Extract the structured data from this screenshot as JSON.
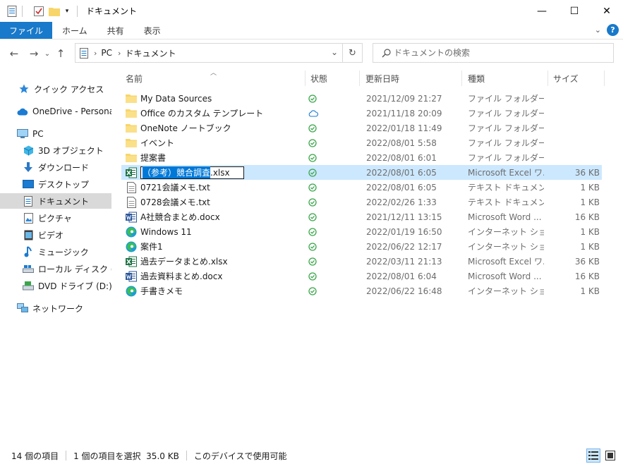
{
  "window": {
    "title": "ドキュメント",
    "minimize": "—",
    "maximize": "☐",
    "close": "✕"
  },
  "ribbon": {
    "tabs": [
      "ファイル",
      "ホーム",
      "共有",
      "表示"
    ]
  },
  "address": {
    "crumbs": [
      "PC",
      "ドキュメント"
    ],
    "search_placeholder": "ドキュメントの検索"
  },
  "sidebar": {
    "items": [
      {
        "label": "クイック アクセス",
        "icon": "star-icon"
      },
      {
        "label": "OneDrive - Personal",
        "icon": "cloud-icon"
      },
      {
        "label": "PC",
        "icon": "pc-icon"
      },
      {
        "label": "3D オブジェクト",
        "icon": "cube-icon"
      },
      {
        "label": "ダウンロード",
        "icon": "download-icon"
      },
      {
        "label": "デスクトップ",
        "icon": "desktop-icon"
      },
      {
        "label": "ドキュメント",
        "icon": "document-icon"
      },
      {
        "label": "ピクチャ",
        "icon": "picture-icon"
      },
      {
        "label": "ビデオ",
        "icon": "video-icon"
      },
      {
        "label": "ミュージック",
        "icon": "music-icon"
      },
      {
        "label": "ローカル ディスク (C:)",
        "icon": "disk-icon"
      },
      {
        "label": "DVD ドライブ (D:) ESD",
        "icon": "dvd-icon"
      },
      {
        "label": "ネットワーク",
        "icon": "network-icon"
      }
    ]
  },
  "columns": {
    "name": "名前",
    "status": "状態",
    "date": "更新日時",
    "type": "種類",
    "size": "サイズ"
  },
  "files": [
    {
      "name": "My Data Sources",
      "icon": "folder-icon",
      "status": "synced",
      "date": "2021/12/09 21:27",
      "type": "ファイル フォルダー",
      "size": ""
    },
    {
      "name": "Office のカスタム テンプレート",
      "icon": "folder-icon",
      "status": "cloud",
      "date": "2021/11/18 20:09",
      "type": "ファイル フォルダー",
      "size": ""
    },
    {
      "name": "OneNote ノートブック",
      "icon": "folder-icon",
      "status": "synced",
      "date": "2022/01/18 11:49",
      "type": "ファイル フォルダー",
      "size": ""
    },
    {
      "name": "イベント",
      "icon": "folder-icon",
      "status": "synced",
      "date": "2022/08/01 5:58",
      "type": "ファイル フォルダー",
      "size": ""
    },
    {
      "name": "提案書",
      "icon": "folder-icon",
      "status": "synced",
      "date": "2022/08/01 6:01",
      "type": "ファイル フォルダー",
      "size": ""
    },
    {
      "name": "（参考）競合調査.xlsx",
      "icon": "excel-icon",
      "status": "synced",
      "date": "2022/08/01 6:05",
      "type": "Microsoft Excel ワ...",
      "size": "36 KB"
    },
    {
      "name": "0721会議メモ.txt",
      "icon": "text-file-icon",
      "status": "synced",
      "date": "2022/08/01 6:05",
      "type": "テキスト ドキュメント",
      "size": "1 KB"
    },
    {
      "name": "0728会議メモ.txt",
      "icon": "text-file-icon",
      "status": "synced",
      "date": "2022/02/26 1:33",
      "type": "テキスト ドキュメント",
      "size": "1 KB"
    },
    {
      "name": "A社競合まとめ.docx",
      "icon": "word-icon",
      "status": "synced",
      "date": "2021/12/11 13:15",
      "type": "Microsoft Word ...",
      "size": "16 KB"
    },
    {
      "name": "Windows 11",
      "icon": "edge-icon",
      "status": "synced",
      "date": "2022/01/19 16:50",
      "type": "インターネット ショート...",
      "size": "1 KB"
    },
    {
      "name": "案件1",
      "icon": "edge-icon",
      "status": "synced",
      "date": "2022/06/22 12:17",
      "type": "インターネット ショート...",
      "size": "1 KB"
    },
    {
      "name": "過去データまとめ.xlsx",
      "icon": "excel-icon",
      "status": "synced",
      "date": "2022/03/11 21:13",
      "type": "Microsoft Excel ワ...",
      "size": "36 KB"
    },
    {
      "name": "過去資料まとめ.docx",
      "icon": "word-icon",
      "status": "synced",
      "date": "2022/08/01 6:04",
      "type": "Microsoft Word ...",
      "size": "16 KB"
    },
    {
      "name": "手書きメモ",
      "icon": "edge-icon",
      "status": "synced",
      "date": "2022/06/22 16:48",
      "type": "インターネット ショート...",
      "size": "1 KB"
    }
  ],
  "rename": {
    "selected_part": "（参考）競合調査",
    "extension": ".xlsx"
  },
  "statusbar": {
    "count": "14 個の項目",
    "selection": "1 個の項目を選択  35.0 KB",
    "availability": "このデバイスで使用可能"
  },
  "colors": {
    "accent": "#1979ca",
    "selection": "#cce8ff",
    "synced": "#3aa64a",
    "cloud": "#1c7bd2",
    "folder": "#f8d568"
  }
}
